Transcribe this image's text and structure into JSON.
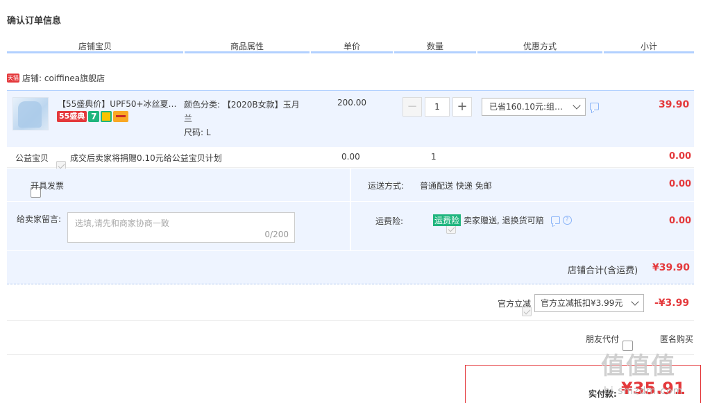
{
  "page_title": "确认订单信息",
  "columns": [
    "店铺宝贝",
    "商品属性",
    "单价",
    "数量",
    "优惠方式",
    "小计"
  ],
  "shop": {
    "badge": "天猫",
    "label": "店铺: coiffinea旗舰店"
  },
  "item": {
    "name": "【55盛典价】UPF50+冰丝夏…",
    "badge_55": "55盛典",
    "badge_7": "7",
    "props_line1": "颜色分类: 【2020B女款】玉月",
    "props_line2": "兰",
    "props_line3": "尺码: L",
    "unit_price": "200.00",
    "quantity": "1",
    "promo": "已省160.10元:组…",
    "subtotal": "39.90"
  },
  "charity": {
    "label": "公益宝贝",
    "text": "成交后卖家将捐赠0.10元给公益宝贝计划",
    "price": "0.00",
    "quantity": "1",
    "subtotal": "0.00"
  },
  "invoice_label": "开具发票",
  "shipping": {
    "label": "运送方式:",
    "value": "普通配送 快递 免邮",
    "price": "0.00"
  },
  "message": {
    "label": "给卖家留言:",
    "placeholder": "选填,请先和商家协商一致",
    "counter": "0/200"
  },
  "freight_insurance": {
    "label": "运费险:",
    "tag": "运费险",
    "text": "卖家赠送, 退换货可赔",
    "price": "0.00"
  },
  "shop_total": {
    "label": "店铺合计(含运费)",
    "value": "¥39.90"
  },
  "official_discount": {
    "label": "官方立减",
    "select": "官方立减抵扣¥3.99元",
    "value": "-¥3.99"
  },
  "friend_pay": "朋友代付",
  "anonymous": "匿名购买",
  "actual_pay": {
    "label": "实付款:",
    "value": "¥35.91"
  },
  "watermark": {
    "text": "值值值",
    "site": "hi.smzdm.com"
  }
}
